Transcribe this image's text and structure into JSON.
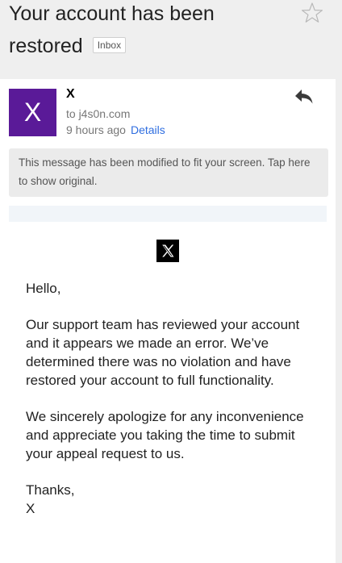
{
  "subject": {
    "line1": "Your account has been",
    "line2": "restored",
    "badge": "Inbox"
  },
  "message": {
    "avatar_letter": "X",
    "sender": "X",
    "to": "to j4s0n.com",
    "time": "9 hours ago",
    "details_label": "Details",
    "notice": "This message has been modified to fit your screen. Tap here to show original.",
    "greeting": "Hello,",
    "paragraph1": "Our support team has reviewed your account and it appears we made an error. We’ve determined there was no violation and have restored your account to full functionality.",
    "paragraph2": "We sincerely apologize for any inconvenience and appreciate you taking the time to submit your appeal request to us.",
    "signoff": "Thanks,",
    "signature": "X"
  },
  "icons": {
    "star": "star-outline-icon",
    "reply": "reply-arrow-icon",
    "logo": "x-logo-icon"
  },
  "colors": {
    "avatar": "#5a1a98",
    "link": "#2f6ee0",
    "notice_bg": "#ebebeb"
  }
}
